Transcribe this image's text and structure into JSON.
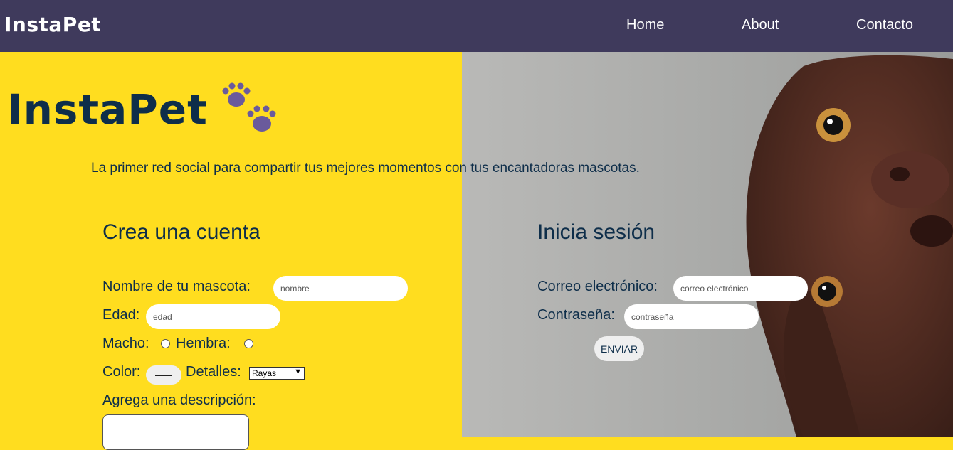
{
  "nav": {
    "logo": "InstaPet",
    "links": [
      "Home",
      "About",
      "Contacto"
    ]
  },
  "hero": {
    "logo": "InstaPet",
    "tagline": "La primer red social para compartir tus mejores momentos con tus encantadoras mascotas."
  },
  "register": {
    "title": "Crea una cuenta",
    "pet_name_label": "Nombre de tu mascota:",
    "pet_name_placeholder": "nombre",
    "age_label": "Edad:",
    "age_placeholder": "edad",
    "male_label": "Macho:",
    "female_label": "Hembra:",
    "color_label": "Color:",
    "details_label": "Detalles:",
    "details_value": "Rayas",
    "description_label": "Agrega una descripción:"
  },
  "login": {
    "title": "Inicia sesión",
    "email_label": "Correo electrónico:",
    "email_placeholder": "correo electrónico",
    "password_label": "Contraseña:",
    "password_placeholder": "contraseña",
    "submit_label": "ENVIAR"
  },
  "colors": {
    "navbar": "#3f3a5c",
    "yellow": "#ffdd1f",
    "text_dark": "#0e2e4a",
    "paw": "#6a5a9c"
  }
}
